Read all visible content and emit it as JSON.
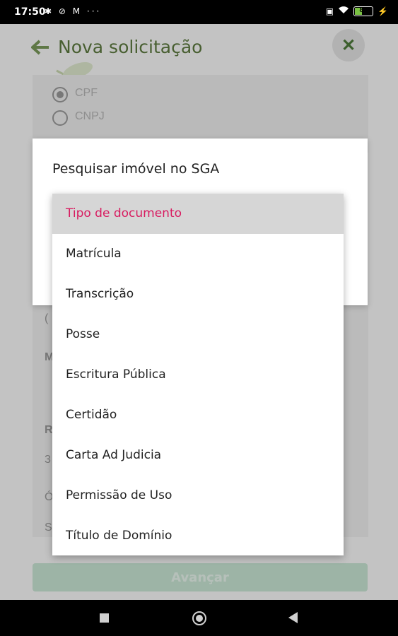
{
  "status_bar": {
    "time": "17:50",
    "left_icons": "✱ ⊘ M ···",
    "battery": "82"
  },
  "header": {
    "title": "Nova solicitação"
  },
  "background": {
    "radio_options": [
      "CPF",
      "CNPJ"
    ],
    "fragments": [
      "(",
      "M",
      "R",
      "3",
      "Ó",
      "S"
    ],
    "submit_label": "Avançar"
  },
  "dialog": {
    "title": "Pesquisar imóvel no SGA"
  },
  "dropdown": {
    "options": [
      "Tipo de documento",
      "Matrícula",
      "Transcrição",
      "Posse",
      "Escritura Pública",
      "Certidão",
      "Carta Ad Judicia",
      "Permissão de Uso",
      "Título de Domínio"
    ],
    "selected_index": 0,
    "selected_color": "#d81b60"
  },
  "colors": {
    "accent_green": "#5d7a3f",
    "button_disabled": "#c9e7d5"
  }
}
